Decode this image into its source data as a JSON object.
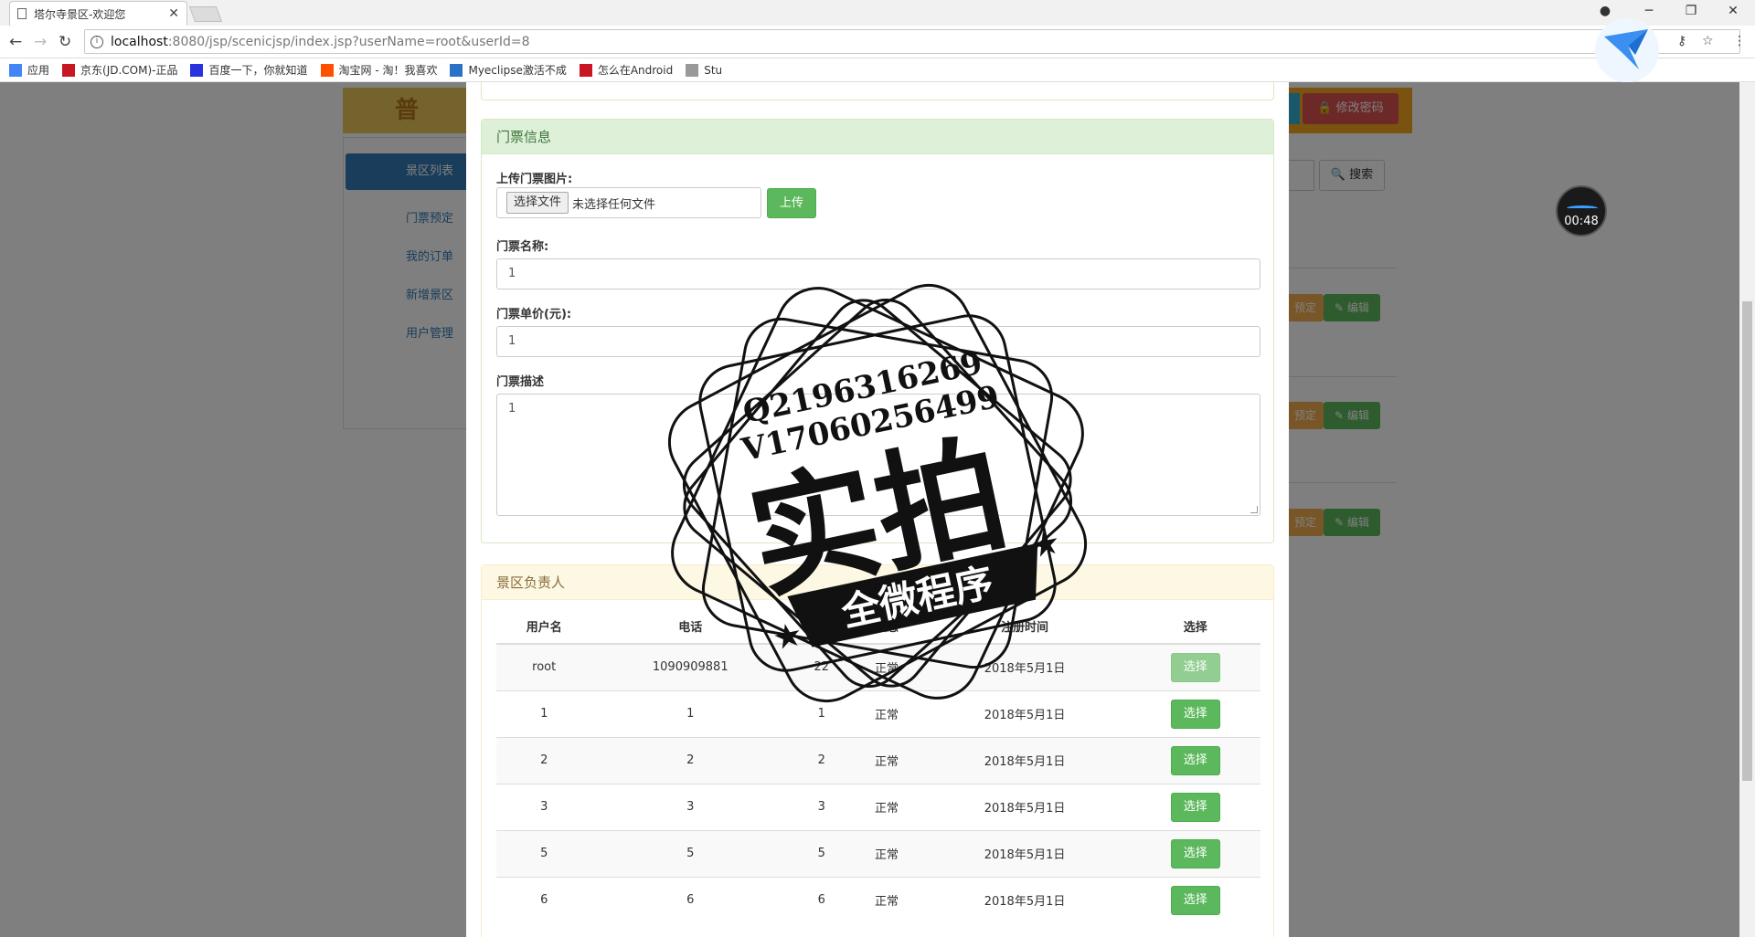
{
  "browser": {
    "tab_title": "塔尔寺景区-欢迎您",
    "url_host": "localhost",
    "url_path": ":8080/jsp/scenicjsp/index.jsp?userName=root&userId=8",
    "bookmarks": [
      {
        "label": "应用",
        "color": "#4285f4"
      },
      {
        "label": "京东(JD.COM)-正品",
        "color": "#c91623"
      },
      {
        "label": "百度一下，你就知道",
        "color": "#2932e1"
      },
      {
        "label": "淘宝网 - 淘！我喜欢",
        "color": "#ff5000"
      },
      {
        "label": "Myeclipse激活不成",
        "color": "#2a72c8"
      },
      {
        "label": "怎么在Android",
        "color": "#c91623"
      },
      {
        "label": "Stu",
        "color": "#999999"
      }
    ]
  },
  "background": {
    "logo_text": "普",
    "change_password": "修改密码",
    "search": "搜索",
    "sidebar": [
      "景区列表",
      "门票预定",
      "我的订单",
      "新增景区",
      "用户管理"
    ],
    "book_stub": "预定",
    "edit": "编辑"
  },
  "ticket_panel": {
    "heading": "门票信息",
    "upload_label": "上传门票图片:",
    "choose_file": "选择文件",
    "no_file": "未选择任何文件",
    "upload_button": "上传",
    "name_label": "门票名称:",
    "name_value": "1",
    "price_label": "门票单价(元):",
    "price_value": "1",
    "desc_label": "门票描述",
    "desc_value": "1"
  },
  "manager_panel": {
    "heading": "景区负责人",
    "columns": [
      "用户名",
      "电话",
      "邮箱",
      "状态",
      "注册时间",
      "选择"
    ],
    "rows": [
      {
        "username": "root",
        "phone": "1090909881",
        "email": "22",
        "status": "正常",
        "registered": "2018年5月1日",
        "action": "选择",
        "disabled": true
      },
      {
        "username": "1",
        "phone": "1",
        "email": "1",
        "status": "正常",
        "registered": "2018年5月1日",
        "action": "选择",
        "disabled": false
      },
      {
        "username": "2",
        "phone": "2",
        "email": "2",
        "status": "正常",
        "registered": "2018年5月1日",
        "action": "选择",
        "disabled": false
      },
      {
        "username": "3",
        "phone": "3",
        "email": "3",
        "status": "正常",
        "registered": "2018年5月1日",
        "action": "选择",
        "disabled": false
      },
      {
        "username": "5",
        "phone": "5",
        "email": "5",
        "status": "正常",
        "registered": "2018年5月1日",
        "action": "选择",
        "disabled": false
      },
      {
        "username": "6",
        "phone": "6",
        "email": "6",
        "status": "正常",
        "registered": "2018年5月1日",
        "action": "选择",
        "disabled": false
      }
    ]
  },
  "recorder": {
    "time": "00:48"
  },
  "watermark": {
    "line1": "Q2196316269",
    "line2": "V17060256499",
    "main": "实拍",
    "banner": "全微程序"
  }
}
